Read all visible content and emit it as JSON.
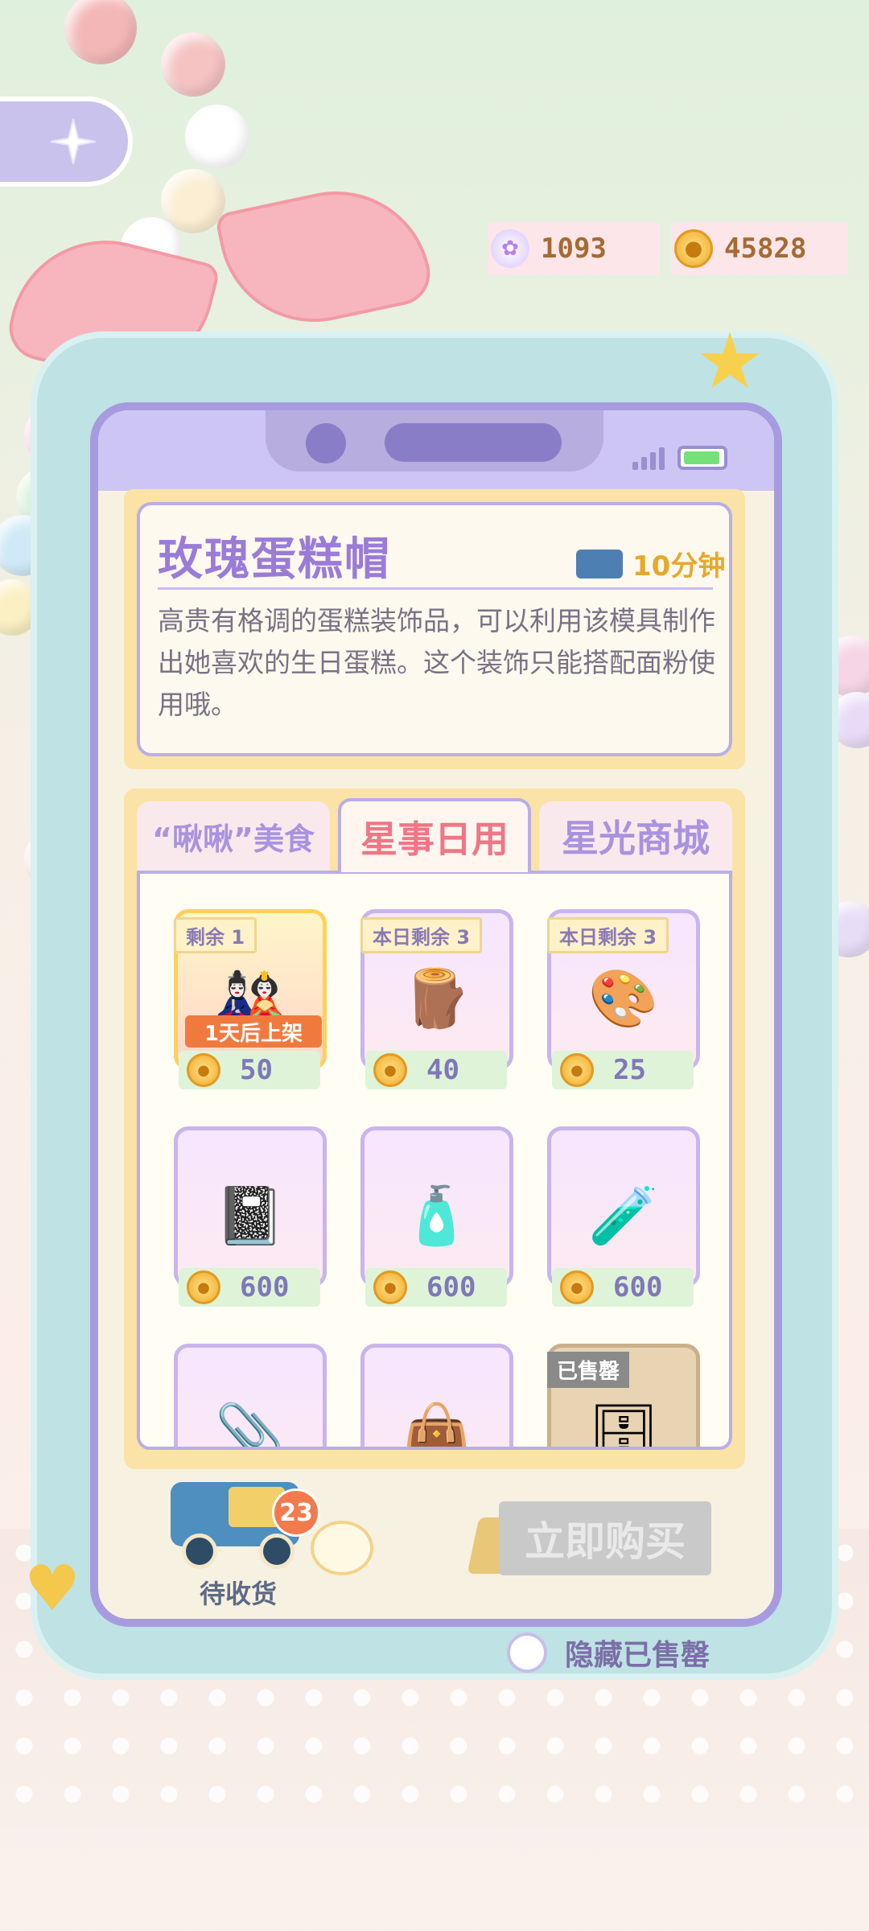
{
  "currency": {
    "gems": "1093",
    "coins": "45828"
  },
  "item_info": {
    "title": "玫瑰蛋糕帽",
    "delivery_time": "10分钟",
    "description": "高贵有格调的蛋糕装饰品，可以利用该模具制作出她喜欢的生日蛋糕。这个装饰只能搭配面粉使用哦。"
  },
  "tabs": [
    {
      "label": "“啾啾”美食",
      "active": false
    },
    {
      "label": "星事日用",
      "active": true
    },
    {
      "label": "星光商城",
      "active": false
    }
  ],
  "items": [
    {
      "stock": "剩余 1",
      "price": "50",
      "restock": "1天后上架",
      "icon": "character-bundle"
    },
    {
      "stock": "本日剩余 3",
      "price": "40",
      "icon": "log-roll"
    },
    {
      "stock": "本日剩余 3",
      "price": "25",
      "icon": "paint-box"
    },
    {
      "price": "600",
      "icon": "notebook-pen"
    },
    {
      "price": "600",
      "icon": "water-bottle"
    },
    {
      "price": "600",
      "icon": "sunscreen-tube"
    },
    {
      "icon": "hair-clip"
    },
    {
      "icon": "tote-bag"
    },
    {
      "sold_out": "已售罄",
      "icon": "shelf"
    }
  ],
  "bottom": {
    "pending_label": "待收货",
    "pending_count": "23",
    "buy_label": "立即购买",
    "hide_sold_label": "隐藏已售罄"
  }
}
